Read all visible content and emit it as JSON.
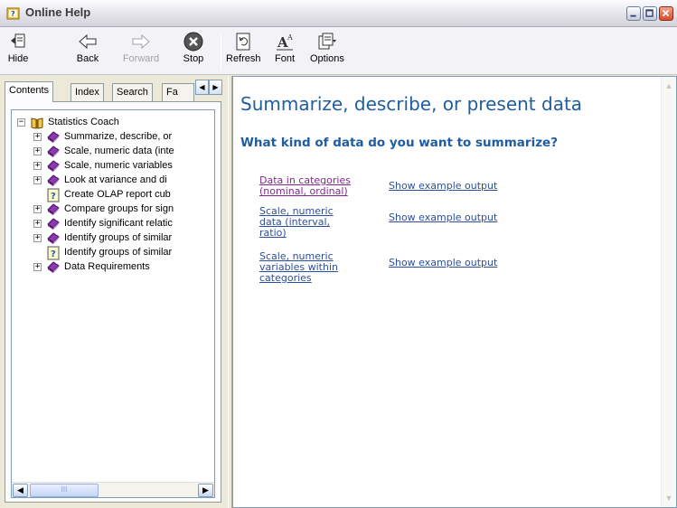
{
  "window": {
    "title": "Online Help"
  },
  "toolbar": {
    "hide": "Hide",
    "back": "Back",
    "forward": "Forward",
    "stop": "Stop",
    "refresh": "Refresh",
    "font": "Font",
    "options": "Options"
  },
  "tabs": {
    "contents": "Contents",
    "index": "Index",
    "search": "Search",
    "favorites": "Fa"
  },
  "tree": {
    "root": "Statistics Coach",
    "items": [
      "Summarize, describe, or",
      "Scale, numeric data (inte",
      "Scale, numeric variables",
      "Look at variance and di",
      "Create OLAP report cub",
      "Compare groups for sign",
      "Identify significant relatic",
      "Identify groups of similar",
      "Identify groups of similar",
      "Data Requirements"
    ]
  },
  "content": {
    "heading": "Summarize, describe, or present data",
    "subheading": "What kind of data do you want to summarize?",
    "options": [
      {
        "line1": "Data in categories",
        "line2": "(nominal, ordinal)",
        "line3": "",
        "example": "Show example output"
      },
      {
        "line1": "Scale, numeric",
        "line2": "data (interval,",
        "line3": "ratio)",
        "example": "Show example output"
      },
      {
        "line1": "Scale, numeric",
        "line2": "variables within",
        "line3": "categories",
        "example": "Show example output"
      }
    ]
  },
  "scrollbar": {
    "thumb_grip": "III"
  }
}
